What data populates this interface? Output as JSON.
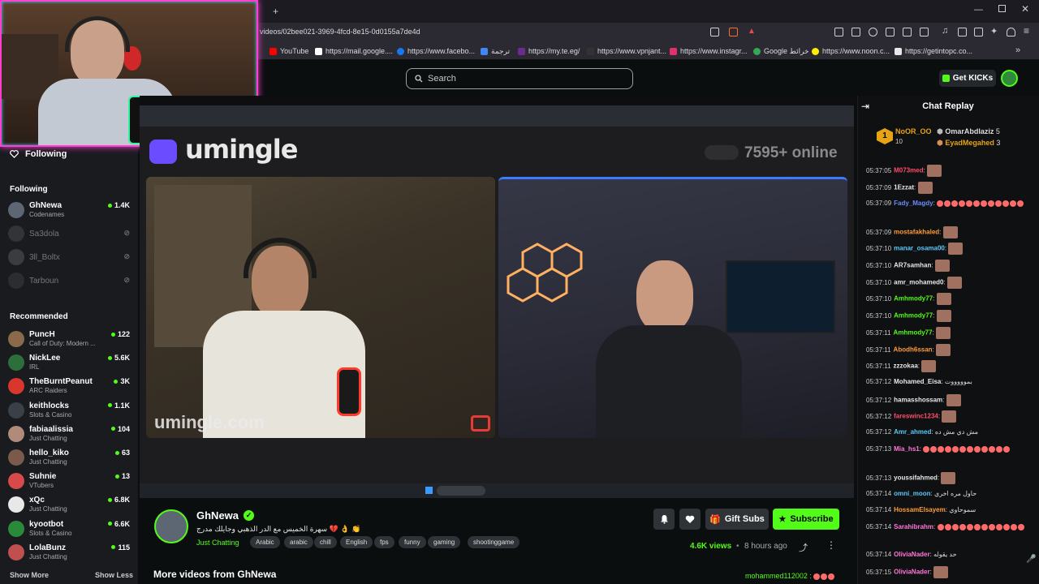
{
  "browser": {
    "url": "videos/02bee021-3969-4fcd-8e15-0d0155a7de4d",
    "bookmarks": [
      "YouTube",
      "https://mail.google....",
      "https://www.facebo...",
      "ترجمة",
      "https://my.te.eg/",
      "https://www.vpnjant...",
      "https://www.instagr...",
      "Google خرائط",
      "https://www.noon.c...",
      "https://getintopc.co..."
    ]
  },
  "topnav": {
    "search_placeholder": "Search",
    "get_kicks": "Get KICKs"
  },
  "sidebar": {
    "following_title": "Following",
    "following_label": "Following",
    "following": [
      {
        "name": "GhNewa",
        "category": "Codenames",
        "viewers": "1.4K",
        "live": true,
        "color": "#5c6773"
      },
      {
        "name": "Sa3dola",
        "category": "",
        "viewers": "",
        "live": false,
        "color": "#555"
      },
      {
        "name": "3ll_Boltx",
        "category": "",
        "viewers": "",
        "live": false,
        "color": "#666"
      },
      {
        "name": "Tarboun",
        "category": "",
        "viewers": "",
        "live": false,
        "color": "#444"
      }
    ],
    "recommended_label": "Recommended",
    "recommended": [
      {
        "name": "PuncH",
        "category": "Call of Duty: Modern ...",
        "viewers": "122",
        "color": "#8a6a4a"
      },
      {
        "name": "NickLee",
        "category": "IRL",
        "viewers": "5.6K",
        "color": "#2c6f3a"
      },
      {
        "name": "TheBurntPeanut",
        "category": "ARC Raiders",
        "viewers": "3K",
        "color": "#d9362e"
      },
      {
        "name": "keithlocks",
        "category": "Slots & Casino",
        "viewers": "1.1K",
        "color": "#3a3f48"
      },
      {
        "name": "fabiaalissia",
        "category": "Just Chatting",
        "viewers": "104",
        "color": "#b08a7a"
      },
      {
        "name": "hello_kiko",
        "category": "Just Chatting",
        "viewers": "63",
        "color": "#7a5a4a"
      },
      {
        "name": "Suhnie",
        "category": "VTubers",
        "viewers": "13",
        "color": "#d84a4a"
      },
      {
        "name": "xQc",
        "category": "Just Chatting",
        "viewers": "6.8K",
        "color": "#e8e8e8"
      },
      {
        "name": "kyootbot",
        "category": "Slots & Casino",
        "viewers": "6.6K",
        "color": "#2a8a3a"
      },
      {
        "name": "LolaBunz",
        "category": "Just Chatting",
        "viewers": "115",
        "color": "#c05050"
      }
    ],
    "show_more": "Show More",
    "show_less": "Show Less"
  },
  "video": {
    "site_logo": "umingle",
    "online_count": "7595+ online",
    "watermark": "umingle.com"
  },
  "stream": {
    "streamer": "GhNewa",
    "title": "سهرة الخميس مع الدر الذهبي وجايلك مدرج 💔 👌 👏",
    "category": "Just Chatting",
    "tags": [
      "Arabic",
      "arabic",
      "chill",
      "English",
      "fps",
      "funny",
      "gaming",
      "shootinggame"
    ],
    "gift_subs": "Gift Subs",
    "subscribe": "Subscribe",
    "views": "4.6K views",
    "ago": "8 hours ago",
    "more_videos": "More videos from GhNewa",
    "bottom_chat_user": "mohammed112002 :"
  },
  "chat": {
    "title": "Chat Replay",
    "gifters": [
      {
        "rank": "1",
        "name": "NoOR_OO",
        "count": "10"
      },
      {
        "name": "OmarAbdlaziz",
        "count": "5"
      },
      {
        "name": "EyadMegahed",
        "count": "3"
      }
    ],
    "messages": [
      {
        "time": "05:37:05",
        "user": "M073med",
        "color": "#ff4d6a",
        "text": ""
      },
      {
        "time": "05:37:09",
        "user": "1Ezzat",
        "color": "#e8e8e8",
        "text": ""
      },
      {
        "time": "05:37:09",
        "user": "Fady_Magdy",
        "color": "#6a8cff",
        "text": ""
      },
      {
        "time": "05:37:09",
        "user": "mostafakhaled",
        "color": "#ff9c3a",
        "text": ""
      },
      {
        "time": "05:37:10",
        "user": "manar_osama00",
        "color": "#5ac8fa",
        "text": ""
      },
      {
        "time": "05:37:10",
        "user": "AR7samhan",
        "color": "#e8e8e8",
        "text": ""
      },
      {
        "time": "05:37:10",
        "user": "amr_mohamed0",
        "color": "#e8e8e8",
        "text": ""
      },
      {
        "time": "05:37:10",
        "user": "Amhmody77",
        "color": "#53fc18",
        "text": ""
      },
      {
        "time": "05:37:10",
        "user": "Amhmody77",
        "color": "#53fc18",
        "text": ""
      },
      {
        "time": "05:37:11",
        "user": "Amhmody77",
        "color": "#53fc18",
        "text": ""
      },
      {
        "time": "05:37:11",
        "user": "Abodh6ssan",
        "color": "#ff9c3a",
        "text": ""
      },
      {
        "time": "05:37:11",
        "user": "zzzokaa",
        "color": "#e8e8e8",
        "text": ""
      },
      {
        "time": "05:37:12",
        "user": "Mohamed_Eisa",
        "color": "#e8e8e8",
        "text": "بموووووت"
      },
      {
        "time": "05:37:12",
        "user": "hamasshossam",
        "color": "#e8e8e8",
        "text": ""
      },
      {
        "time": "05:37:12",
        "user": "fareswinc1234",
        "color": "#ff4d6a",
        "text": ""
      },
      {
        "time": "05:37:12",
        "user": "Amr_ahmed",
        "color": "#5ac8fa",
        "text": "مش دي مش ده"
      },
      {
        "time": "05:37:13",
        "user": "Mia_hs1",
        "color": "#ff77d9",
        "text": ""
      },
      {
        "time": "05:37:13",
        "user": "youssifahmed",
        "color": "#e8e8e8",
        "text": ""
      },
      {
        "time": "05:37:14",
        "user": "omni_moon",
        "color": "#5ac8fa",
        "text": "حاول مره اخري"
      },
      {
        "time": "05:37:14",
        "user": "HossamElsayem",
        "color": "#ff9c3a",
        "text": "سموحاوي"
      },
      {
        "time": "05:37:14",
        "user": "Sarahibrahm",
        "color": "#ff77d9",
        "text": ""
      },
      {
        "time": "05:37:14",
        "user": "OliviaNader",
        "color": "#ff77d9",
        "text": "حد يقوله"
      },
      {
        "time": "05:37:15",
        "user": "OliviaNader",
        "color": "#ff77d9",
        "text": ""
      }
    ]
  }
}
